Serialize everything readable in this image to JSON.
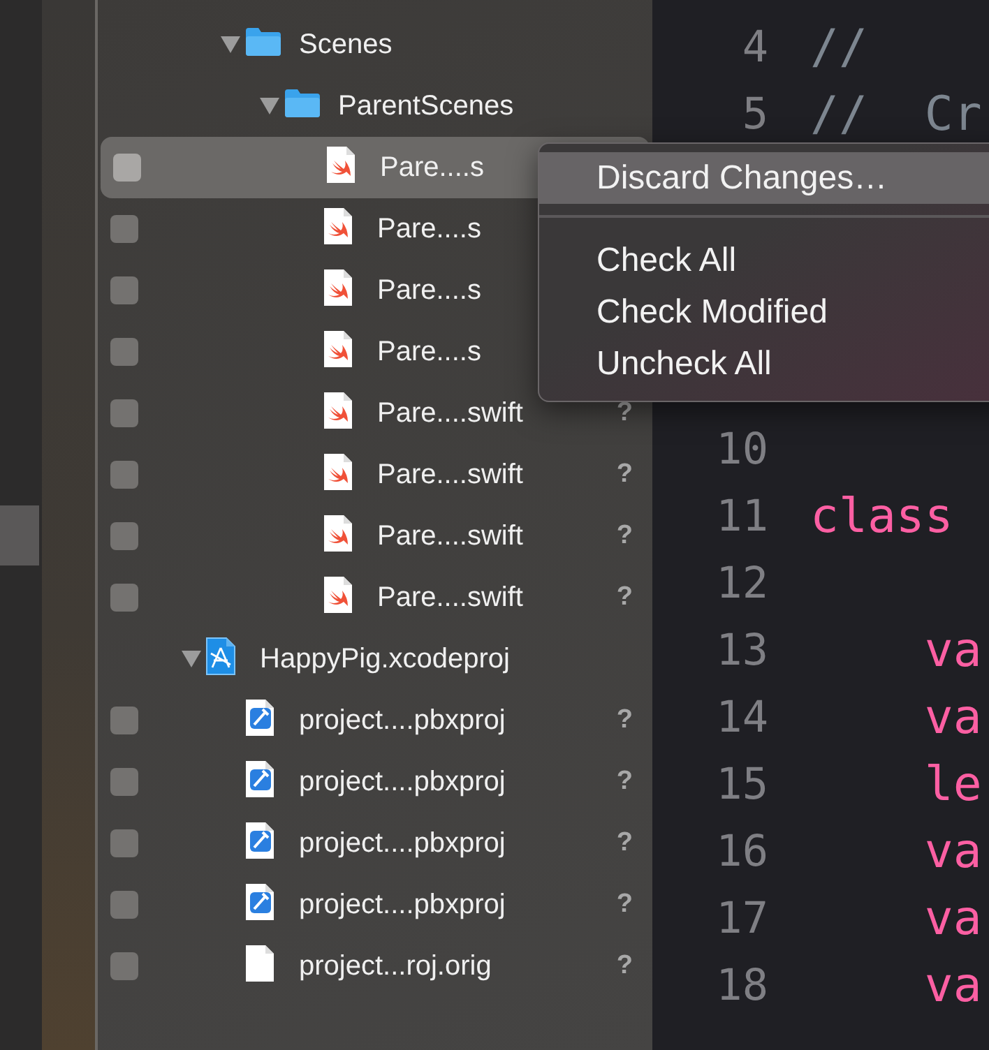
{
  "left_strip": {
    "items": [
      {
        "selected": true
      }
    ]
  },
  "tree": [
    {
      "children": [
        {
          "name": "Scenes",
          "kind": "folder",
          "expanded": true,
          "children": [
            {
              "name": "ParentScenes",
              "kind": "folder",
              "expanded": true,
              "children": [
                {
                  "name": "Pare....s",
                  "kind": "swift",
                  "checked": false,
                  "selected": true
                },
                {
                  "name": "Pare....s",
                  "kind": "swift",
                  "checked": false,
                  "selected": false
                },
                {
                  "name": "Pare....s",
                  "kind": "swift",
                  "checked": false,
                  "selected": false
                },
                {
                  "name": "Pare....s",
                  "kind": "swift",
                  "checked": false,
                  "selected": false
                },
                {
                  "name": "Pare....swift",
                  "kind": "swift",
                  "checked": false,
                  "selected": false,
                  "status": "?"
                },
                {
                  "name": "Pare....swift",
                  "kind": "swift",
                  "checked": false,
                  "selected": false,
                  "status": "?"
                },
                {
                  "name": "Pare....swift",
                  "kind": "swift",
                  "checked": false,
                  "selected": false,
                  "status": "?"
                },
                {
                  "name": "Pare....swift",
                  "kind": "swift",
                  "checked": false,
                  "selected": false,
                  "status": "?"
                }
              ]
            }
          ]
        }
      ]
    },
    {
      "name": "HappyPig.xcodeproj",
      "kind": "xcodeproj",
      "expanded": true,
      "children": [
        {
          "name": "project....pbxproj",
          "kind": "pbxproj",
          "checked": false,
          "selected": false,
          "status": "?"
        },
        {
          "name": "project....pbxproj",
          "kind": "pbxproj",
          "checked": false,
          "selected": false,
          "status": "?"
        },
        {
          "name": "project....pbxproj",
          "kind": "pbxproj",
          "checked": false,
          "selected": false,
          "status": "?"
        },
        {
          "name": "project....pbxproj",
          "kind": "pbxproj",
          "checked": false,
          "selected": false,
          "status": "?"
        },
        {
          "name": "project...roj.orig",
          "kind": "plain",
          "checked": false,
          "selected": false,
          "status": "?"
        }
      ]
    }
  ],
  "code_top": [
    {
      "number": "4",
      "tokens": [
        {
          "kind": "comment",
          "text": "//"
        }
      ]
    },
    {
      "number": "5",
      "tokens": [
        {
          "kind": "comment",
          "text": "//  Cr"
        }
      ]
    }
  ],
  "code_bottom": [
    {
      "number": "10"
    },
    {
      "number": "11",
      "tokens": [
        {
          "kind": "keyword",
          "text": "class"
        }
      ]
    },
    {
      "number": "12"
    },
    {
      "number": "13",
      "tokens": [
        {
          "kind": "keyword",
          "text": "    va"
        }
      ]
    },
    {
      "number": "14",
      "tokens": [
        {
          "kind": "keyword",
          "text": "    va"
        }
      ]
    },
    {
      "number": "15",
      "tokens": [
        {
          "kind": "keyword",
          "text": "    le"
        }
      ]
    },
    {
      "number": "16",
      "tokens": [
        {
          "kind": "keyword",
          "text": "    va"
        }
      ]
    },
    {
      "number": "17",
      "tokens": [
        {
          "kind": "keyword",
          "text": "    va"
        }
      ]
    },
    {
      "number": "18",
      "tokens": [
        {
          "kind": "keyword",
          "text": "    va"
        }
      ]
    }
  ],
  "context_menu": {
    "items": [
      {
        "kind": "item",
        "label": "Discard Changes…",
        "selected": true
      },
      {
        "kind": "separator"
      },
      {
        "kind": "item",
        "label": "Check All",
        "selected": false
      },
      {
        "kind": "item",
        "label": "Check Modified",
        "selected": false
      },
      {
        "kind": "item",
        "label": "Uncheck All",
        "selected": false
      }
    ]
  }
}
